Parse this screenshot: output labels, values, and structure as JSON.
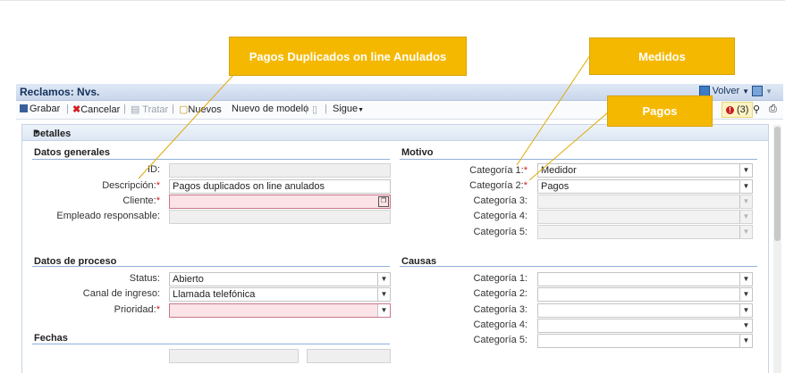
{
  "callouts": {
    "pagos_duplicados": "Pagos Duplicados on line Anulados",
    "medidos": "Medidos",
    "pagos": "Pagos"
  },
  "window": {
    "title": "Reclamos: Nvs.",
    "volver_label": "Volver"
  },
  "toolbar": {
    "grabar": "Grabar",
    "cancelar": "Cancelar",
    "tratar": "Tratar",
    "nuevos": "Nuevos",
    "nuevo_de_modelo": "Nuevo de modelo",
    "sigue": "Sigue",
    "alerts_count": "(3)"
  },
  "panel": {
    "title": "Detalles"
  },
  "datos_generales": {
    "title": "Datos generales",
    "id_label": "ID:",
    "id_value": "",
    "descripcion_label": "Descripción:",
    "descripcion_value": "Pagos duplicados on line anulados",
    "cliente_label": "Cliente:",
    "cliente_value": "",
    "empleado_label": "Empleado responsable:",
    "empleado_value": ""
  },
  "datos_proceso": {
    "title": "Datos de proceso",
    "status_label": "Status:",
    "status_value": "Abierto",
    "canal_label": "Canal de ingreso:",
    "canal_value": "Llamada telefónica",
    "prioridad_label": "Prioridad:",
    "prioridad_value": ""
  },
  "fechas": {
    "title": "Fechas"
  },
  "motivo": {
    "title": "Motivo",
    "cat1_label": "Categoría 1:",
    "cat1_value": "Medidor",
    "cat2_label": "Categoría 2:",
    "cat2_value": "Pagos",
    "cat3_label": "Categoría 3:",
    "cat4_label": "Categoría 4:",
    "cat5_label": "Categoría 5:"
  },
  "causas": {
    "title": "Causas",
    "cat1_label": "Categoría 1:",
    "cat2_label": "Categoría 2:",
    "cat3_label": "Categoría 3:",
    "cat4_label": "Categoría 4:",
    "cat5_label": "Categoría 5:"
  },
  "colors": {
    "callout": "#f5b800",
    "error_field": "#fbe3e7",
    "section_line": "#8fb0d8"
  }
}
